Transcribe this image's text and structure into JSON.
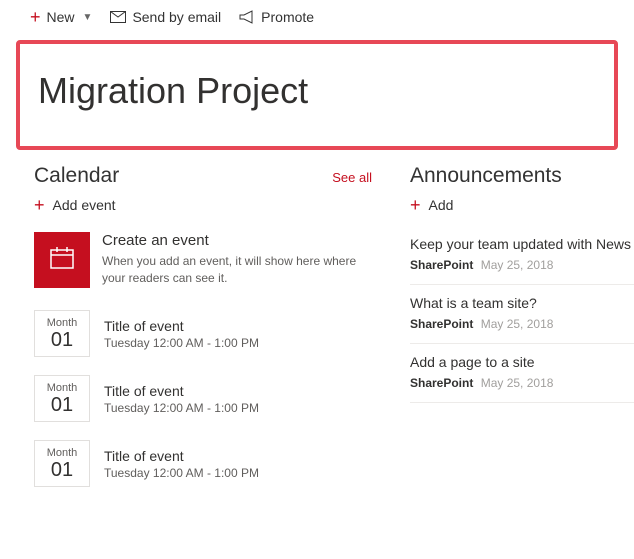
{
  "toolbar": {
    "new_label": "New",
    "send_label": "Send by email",
    "promote_label": "Promote"
  },
  "page_title": "Migration Project",
  "calendar": {
    "heading": "Calendar",
    "see_all": "See all",
    "add_label": "Add event",
    "promo": {
      "title": "Create an event",
      "desc": "When you add an event, it will show here where your readers can see it."
    },
    "events": [
      {
        "month": "Month",
        "day": "01",
        "title": "Title of event",
        "time": "Tuesday 12:00 AM - 1:00 PM"
      },
      {
        "month": "Month",
        "day": "01",
        "title": "Title of event",
        "time": "Tuesday 12:00 AM - 1:00 PM"
      },
      {
        "month": "Month",
        "day": "01",
        "title": "Title of event",
        "time": "Tuesday 12:00 AM - 1:00 PM"
      }
    ]
  },
  "announcements": {
    "heading": "Announcements",
    "add_label": "Add",
    "items": [
      {
        "title": "Keep your team updated with News",
        "source": "SharePoint",
        "date": "May 25, 2018"
      },
      {
        "title": "What is a team site?",
        "source": "SharePoint",
        "date": "May 25, 2018"
      },
      {
        "title": "Add a page to a site",
        "source": "SharePoint",
        "date": "May 25, 2018"
      }
    ]
  }
}
